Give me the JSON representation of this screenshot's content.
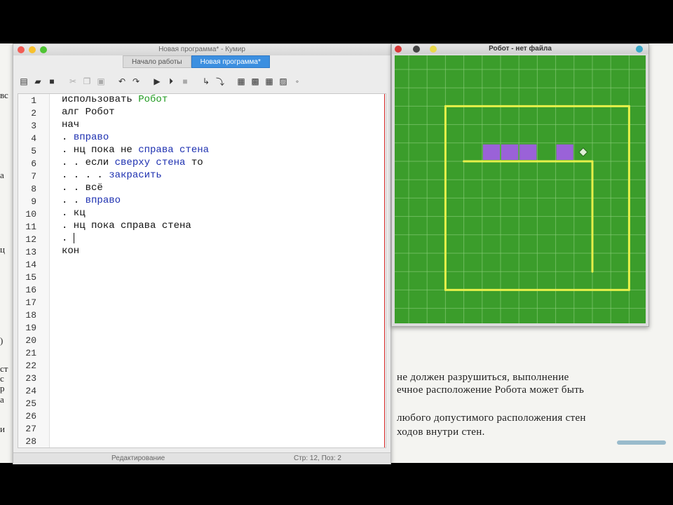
{
  "editor": {
    "window_title": "Новая программа* - Кумир",
    "tabs": [
      {
        "label": "Начало работы"
      },
      {
        "label": "Новая программа*"
      }
    ],
    "toolbar": [
      {
        "name": "new-file-icon",
        "glyph": "▤"
      },
      {
        "name": "open-folder-icon",
        "glyph": "▰"
      },
      {
        "name": "save-icon",
        "glyph": "■"
      },
      {
        "name": "cut-icon",
        "glyph": "✂"
      },
      {
        "name": "copy-icon",
        "glyph": "❐"
      },
      {
        "name": "paste-icon",
        "glyph": "▣"
      },
      {
        "name": "undo-icon",
        "glyph": "↶"
      },
      {
        "name": "redo-icon",
        "glyph": "↷"
      },
      {
        "name": "run-icon",
        "glyph": "▶"
      },
      {
        "name": "run-step-icon",
        "glyph": "⏵"
      },
      {
        "name": "stop-icon",
        "glyph": "■"
      },
      {
        "name": "step-over-icon",
        "glyph": "↳"
      },
      {
        "name": "step-into-icon",
        "glyph": "⤵"
      },
      {
        "name": "grid-icon",
        "glyph": "▦"
      },
      {
        "name": "robot-field-icon",
        "glyph": "▩"
      },
      {
        "name": "table-icon",
        "glyph": "▦"
      },
      {
        "name": "image-icon",
        "glyph": "▨"
      },
      {
        "name": "more-icon",
        "glyph": "◦"
      }
    ],
    "line_numbers": [
      "1",
      "2",
      "3",
      "4",
      "5",
      "6",
      "7",
      "8",
      "9",
      "10",
      "11",
      "12",
      "13",
      "14",
      "15",
      "16",
      "17",
      "18",
      "19",
      "20",
      "21",
      "22",
      "23",
      "24",
      "25",
      "26",
      "27",
      "28"
    ],
    "code_lines": [
      [
        {
          "t": "использовать "
        },
        {
          "t": "Робот",
          "c": "green"
        }
      ],
      [
        {
          "t": "алг "
        },
        {
          "t": "Робот"
        }
      ],
      [
        {
          "t": "нач"
        }
      ],
      [
        {
          "t": ". "
        },
        {
          "t": "вправо",
          "c": "blue"
        }
      ],
      [
        {
          "t": ". нц пока не "
        },
        {
          "t": "справа стена",
          "c": "blue"
        }
      ],
      [
        {
          "t": ". . если "
        },
        {
          "t": "сверху стена",
          "c": "blue"
        },
        {
          "t": " то"
        }
      ],
      [
        {
          "t": ". . . . "
        },
        {
          "t": "закрасить",
          "c": "blue"
        }
      ],
      [
        {
          "t": ". . всё"
        }
      ],
      [
        {
          "t": ". . "
        },
        {
          "t": "вправо",
          "c": "blue"
        }
      ],
      [
        {
          "t": ". кц"
        }
      ],
      [
        {
          "t": ". нц пока справа стена"
        }
      ],
      [
        {
          "t": ". "
        },
        {
          "cursor": true
        }
      ],
      [
        {
          "t": "кон"
        }
      ]
    ],
    "status": {
      "mode": "Редактирование",
      "position": "Стр: 12, Поз: 2"
    }
  },
  "robot_window": {
    "title": "Робот - нет файла",
    "field": {
      "cols": 16,
      "rows": 15,
      "colors": {
        "background": "#3b9d2b",
        "grid": "#8fd07f",
        "wall": "#e6f04a",
        "painted": "#9a62d8",
        "robot": "#e0f0d8"
      },
      "walls": [
        {
          "from": [
            2,
            2
          ],
          "to": [
            12,
            2
          ]
        },
        {
          "from": [
            2,
            2
          ],
          "to": [
            2,
            12
          ]
        },
        {
          "from": [
            12,
            2
          ],
          "to": [
            12,
            12
          ]
        },
        {
          "from": [
            2,
            12
          ],
          "to": [
            12,
            12
          ]
        },
        {
          "from": [
            3,
            5
          ],
          "to": [
            10,
            5
          ]
        },
        {
          "from": [
            10,
            5
          ],
          "to": [
            10,
            11
          ]
        }
      ],
      "painted_cells": [
        [
          4,
          5
        ],
        [
          5,
          5
        ],
        [
          6,
          5
        ],
        [
          8,
          5
        ]
      ],
      "robot_cell": [
        9,
        5
      ]
    }
  },
  "background_doc": {
    "fragments": [
      "вс",
      "а",
      "ц",
      ") ",
      "ст",
      "с",
      "р",
      "а",
      "и"
    ],
    "lines": [
      "не должен разрушиться, выполнение",
      "ечное расположение Робота может быть",
      "любого допустимого расположения стен",
      "ходов внутри стен."
    ]
  }
}
